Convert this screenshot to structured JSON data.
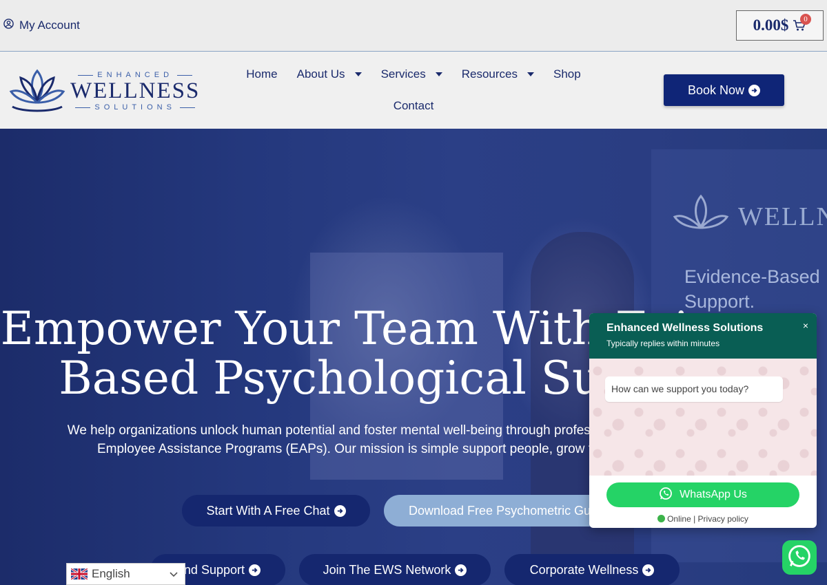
{
  "topbar": {
    "account_label": "My Account",
    "cart_amount": "0.00$",
    "cart_count": "0"
  },
  "header": {
    "logo": {
      "top": "ENHANCED",
      "main": "WELLNESS",
      "bottom": "SOLUTIONS"
    },
    "nav": [
      {
        "label": "Home",
        "dropdown": false
      },
      {
        "label": "About Us",
        "dropdown": true
      },
      {
        "label": "Services",
        "dropdown": true
      },
      {
        "label": "Resources",
        "dropdown": true
      },
      {
        "label": "Shop",
        "dropdown": false
      },
      {
        "label": "Contact",
        "dropdown": false
      }
    ],
    "book_label": "Book Now"
  },
  "hero": {
    "banner_logo": "WELLN",
    "banner_text_1": "Evidence-Based",
    "banner_text_2": "Support.",
    "title_line1": "Empower Your Team With Evi",
    "title_line2": "Based Psychological Sup",
    "subtitle_line1": "We help organizations unlock human potential and foster mental well-being through professiona",
    "subtitle_line2": "Employee Assistance Programs (EAPs). Our mission is simple support people, grow t",
    "buttons": {
      "free_chat": "Start With A Free Chat",
      "download": "Download Free Psychometric Gui",
      "support": "nd Support",
      "network": "Join The EWS Network",
      "corporate": "Corporate Wellness"
    }
  },
  "chat": {
    "name": "Enhanced Wellness Solutions",
    "subtitle": "Typically replies within minutes",
    "close": "×",
    "message": "How can we support you today?",
    "button": "WhatsApp Us",
    "footer": "Online | Privacy policy"
  },
  "language": {
    "selected": "English"
  },
  "colors": {
    "brand_navy": "#0f2577",
    "whatsapp_green": "#25d366",
    "chat_header": "#095e54"
  },
  "icons": [
    "user-circle-icon",
    "cart-icon",
    "arrow-circle-icon",
    "whatsapp-icon",
    "close-icon",
    "uk-flag-icon",
    "chevron-down-icon"
  ]
}
